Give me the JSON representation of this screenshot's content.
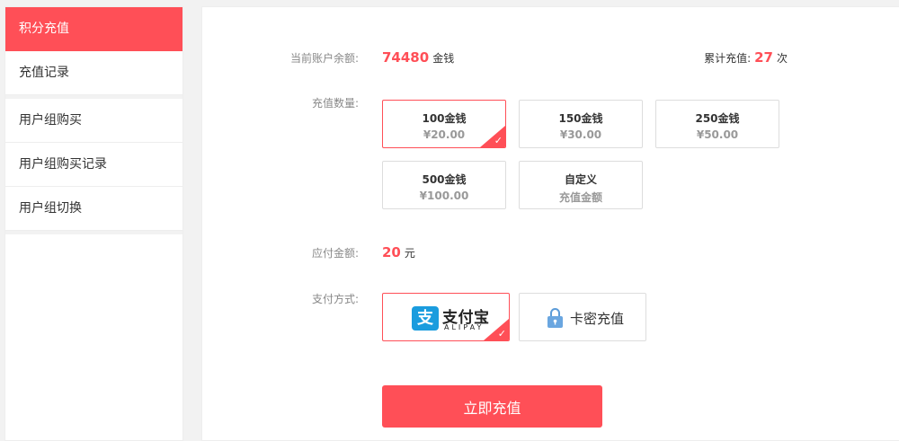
{
  "sidebar": {
    "items": [
      {
        "label": "积分充值"
      },
      {
        "label": "充值记录"
      },
      {
        "label": "用户组购买"
      },
      {
        "label": "用户组购买记录"
      },
      {
        "label": "用户组切换"
      }
    ]
  },
  "account": {
    "balance_label": "当前账户余额:",
    "balance_value": "74480",
    "balance_unit": "金钱",
    "recharge_count_label": "累计充值:",
    "recharge_count_value": "27",
    "recharge_count_unit": "次"
  },
  "quantity": {
    "label": "充值数量:",
    "options": [
      {
        "amount": "100金钱",
        "price": "¥20.00"
      },
      {
        "amount": "150金钱",
        "price": "¥30.00"
      },
      {
        "amount": "250金钱",
        "price": "¥50.00"
      },
      {
        "amount": "500金钱",
        "price": "¥100.00"
      },
      {
        "amount": "自定义",
        "price": "充值金额"
      }
    ],
    "selected_index": 0
  },
  "payable": {
    "label": "应付金额:",
    "value": "20",
    "unit": "元"
  },
  "payment": {
    "label": "支付方式:",
    "alipay_logo_glyph": "支",
    "alipay_name": "支付宝",
    "alipay_en": "ALIPAY",
    "card_label": "卡密充值",
    "selected": "alipay"
  },
  "submit_label": "立即充值",
  "colors": {
    "accent": "#ff4f57",
    "alipay_blue": "#1a9cde"
  }
}
